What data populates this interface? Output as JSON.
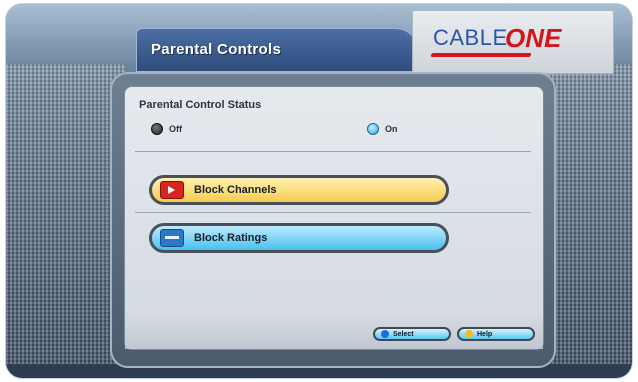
{
  "header": {
    "title": "Parental Controls",
    "logo": {
      "cable": "CABLE",
      "one": "ONE"
    }
  },
  "status": {
    "label": "Parental Control Status",
    "options": [
      {
        "label": "Off",
        "selected": true
      },
      {
        "label": "On",
        "selected": false
      }
    ]
  },
  "menu": {
    "items": [
      {
        "label": "Block Channels",
        "icon": "red-tv-icon",
        "highlight": "#f6cc4f"
      },
      {
        "label": "Block Ratings",
        "icon": "blue-ratings-icon",
        "highlight": "#48c1ef"
      }
    ]
  },
  "footer": {
    "buttons": [
      {
        "label": "Select",
        "icon": "blue-dot-icon"
      },
      {
        "label": "Help",
        "icon": "yellow-dot-icon"
      }
    ]
  },
  "colors": {
    "accent_blue": "#2f4c7c",
    "logo_blue": "#2a56a8",
    "logo_red": "#d4151c"
  }
}
